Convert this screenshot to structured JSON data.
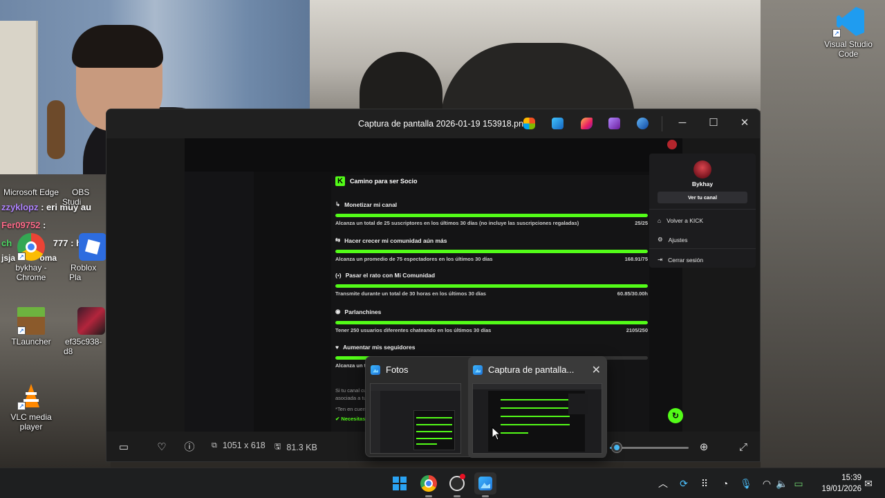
{
  "colors": {
    "kick_green": "#53fc18",
    "accent_blue": "#4cc2ff",
    "viewer_bg": "#1c1c1c"
  },
  "desktop": {
    "icons": [
      {
        "label": "Microsoft Edge",
        "icon": "edge-icon"
      },
      {
        "label": "OBS Studi",
        "icon": "obs-icon"
      },
      {
        "label": "bykhay - Chrome",
        "icon": "chrome-icon"
      },
      {
        "label": "Roblox Pla",
        "icon": "roblox-icon"
      },
      {
        "label": "TLauncher",
        "icon": "minecraft-icon"
      },
      {
        "label": "ef35c938-d8",
        "icon": "image-file-icon"
      },
      {
        "label": "VLC media player",
        "icon": "vlc-icon"
      },
      {
        "label": "Visual Studio Code",
        "icon": "vscode-icon"
      }
    ],
    "chat_overlay": [
      {
        "user": "zzyklopz",
        "text": ": eri muy au",
        "color": "#b084ff"
      },
      {
        "user": "Fer09752",
        "text": ":",
        "color": "#ff6b8a"
      },
      {
        "user": "ch",
        "text": "777 : ha",
        "color": "#4cd964"
      },
      {
        "user": "jsja",
        "text": "oma",
        "color": "#ffffff"
      }
    ]
  },
  "viewer": {
    "title": "Captura de pantalla 2026-01-19 153918.png",
    "controls": {
      "minimize": "─",
      "maximize": "☐",
      "close": "✕"
    },
    "status": {
      "dimensions": "1051 x 618",
      "size": "81.3 KB"
    },
    "screenshot": {
      "heading": "Camino para ser Socio",
      "goals": [
        {
          "title": "Monetizar mi canal",
          "icon": "↳",
          "desc": "Alcanza un total de 25 suscriptores en los últimos 30 días (no incluye las suscripciones regaladas)",
          "value": "25/25",
          "progress": 1.0
        },
        {
          "title": "Hacer crecer mi comunidad aún más",
          "icon": "⇆",
          "desc": "Alcanza un promedio de 75 espectadores en los últimos 30 días",
          "value": "168.91/75",
          "progress": 1.0
        },
        {
          "title": "Pasar el rato con Mi Comunidad",
          "icon": "(•)",
          "desc": "Transmite durante un total de 30 horas en los últimos 30 días",
          "value": "60.85/30.00h",
          "progress": 1.0
        },
        {
          "title": "Parlanchines",
          "icon": "◉",
          "desc": "Tener 250 usuarios diferentes chateando en los últimos 30 días",
          "value": "2105/250",
          "progress": 1.0
        },
        {
          "title": "Aumentar mis seguidores",
          "icon": "♥",
          "desc": "Alcanza un total de 250 seguidores",
          "value": "",
          "progress": 0.35
        }
      ],
      "info1": "Si tu canal cumple con los requisitos, por favo",
      "info2": "asociada a tu cuenta de Kick, con la siguiente",
      "info3": "*Ten en cuenta que cumplir con los requisito",
      "requirement": "Necesitas tener la autenticación de dos fa",
      "menu": {
        "username": "Bykhay",
        "channel_button": "Ver tu canal",
        "items": [
          {
            "label": "Volver a KICK",
            "icon": "home-icon"
          },
          {
            "label": "Ajustes",
            "icon": "gear-icon"
          },
          {
            "label": "Cerrar sesión",
            "icon": "logout-icon"
          }
        ]
      }
    }
  },
  "previews": [
    {
      "label": "Fotos"
    },
    {
      "label": "Captura de pantalla...",
      "close": "✕"
    }
  ],
  "taskbar": {
    "time": "15:39",
    "date": "19/01/2026"
  }
}
